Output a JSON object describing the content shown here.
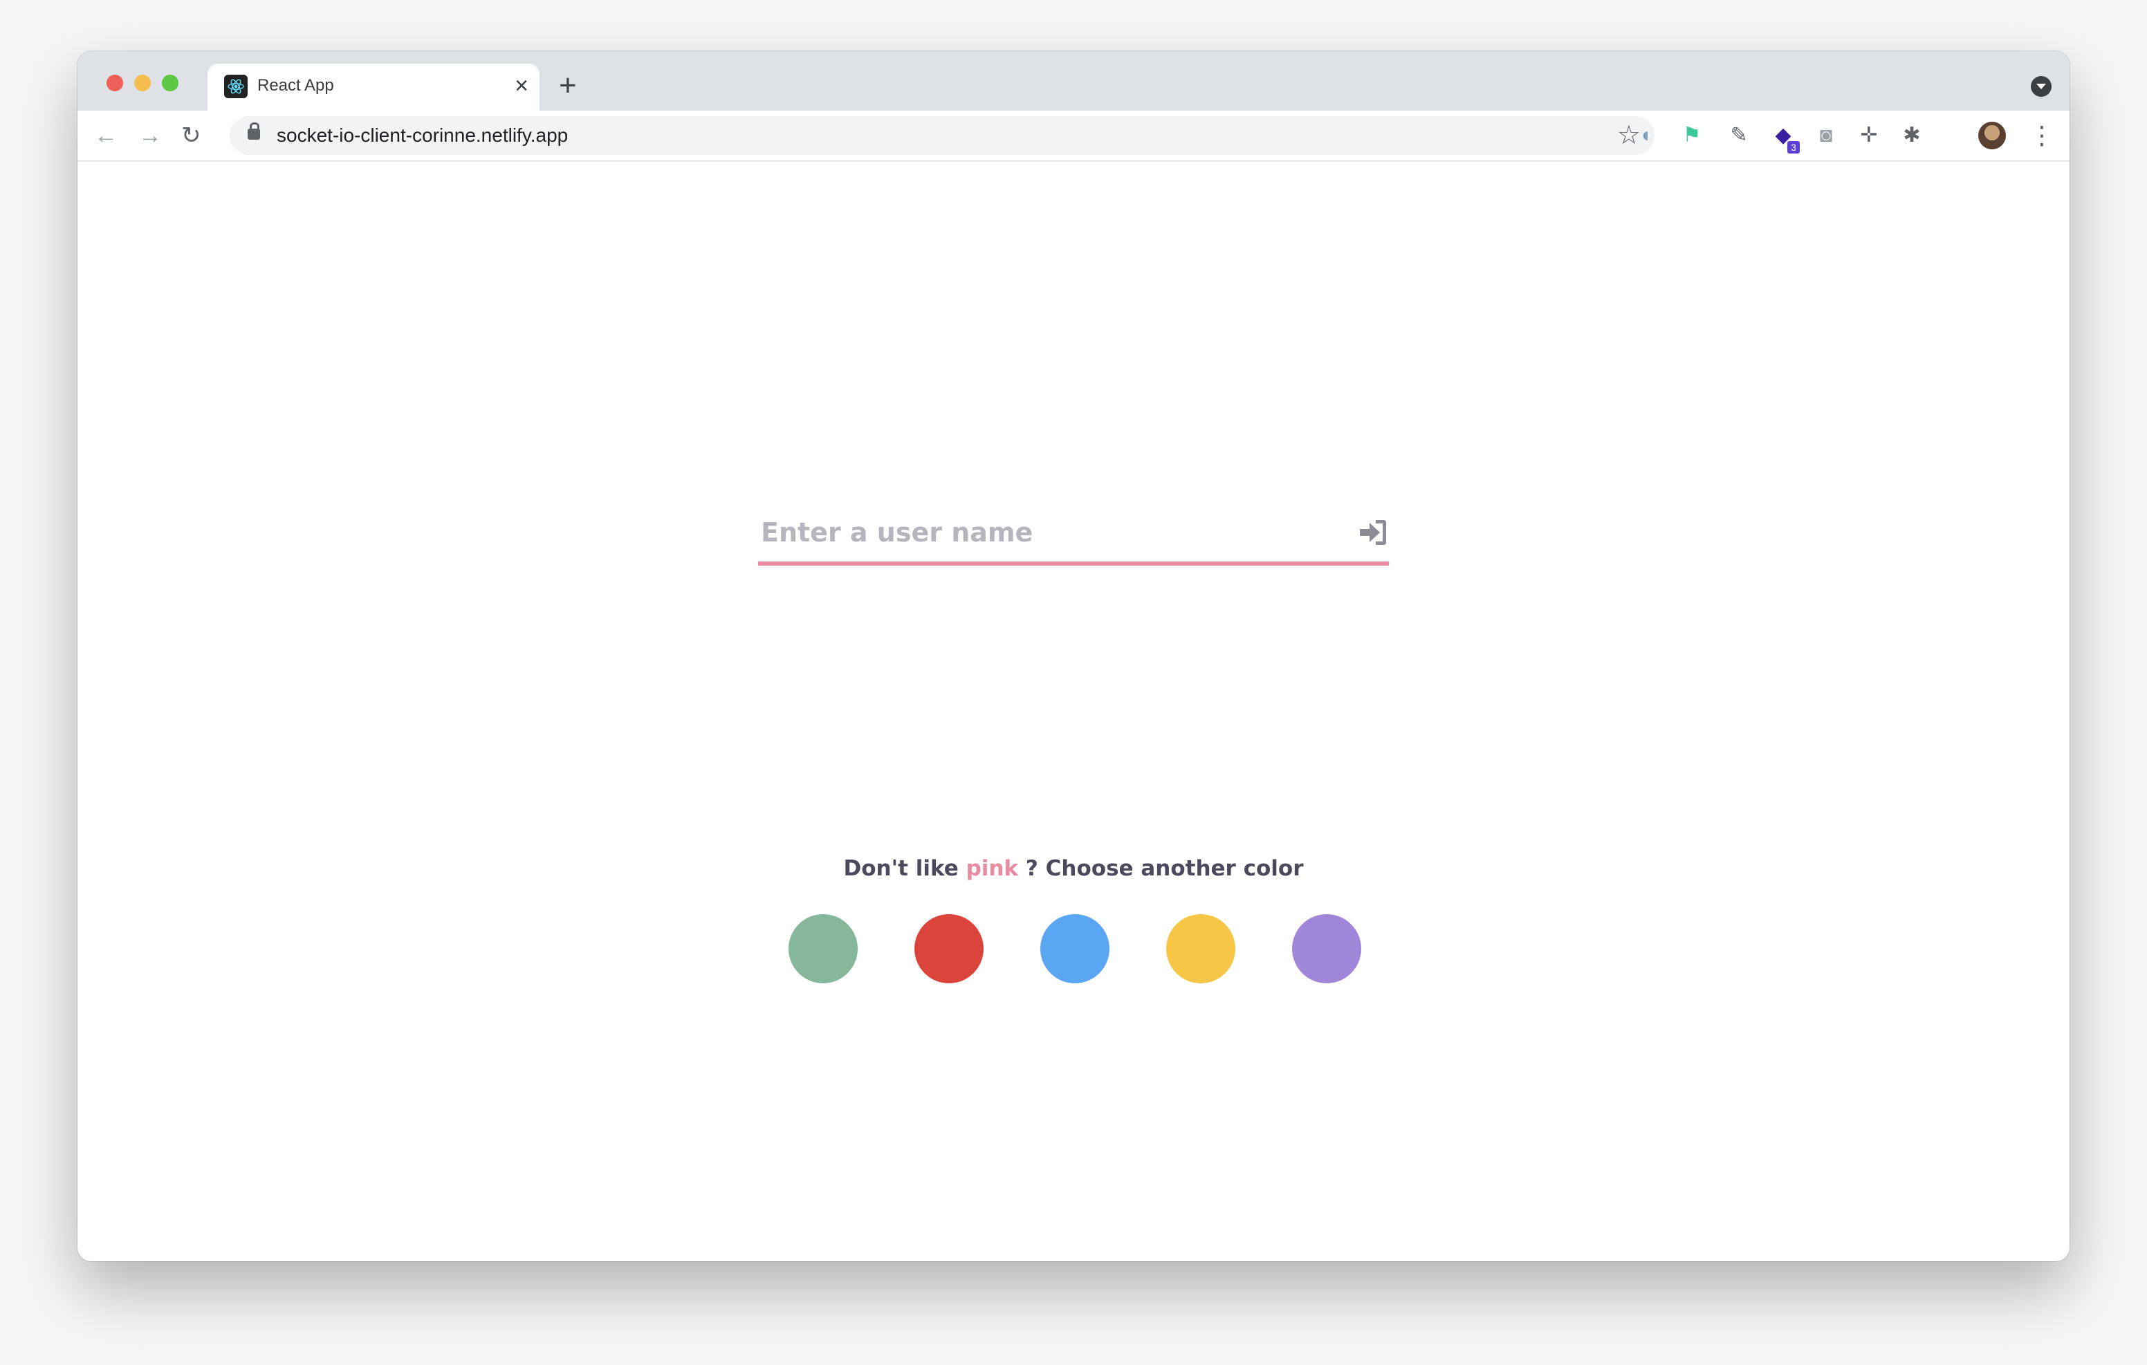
{
  "browser": {
    "tab_title": "React App",
    "tab_close": "×",
    "new_tab": "+",
    "url": "socket-io-client-corinne.netlify.app",
    "nav": {
      "back": "←",
      "forward": "→",
      "reload": "↻"
    },
    "bookmark_star": "☆",
    "menu": "⋮",
    "extensions": [
      {
        "name": "privacy-badger-icon",
        "glyph": "◐",
        "color": "#7ea1c4"
      },
      {
        "name": "hummingbird-icon",
        "glyph": "⚑",
        "color": "#3cc79a"
      },
      {
        "name": "color-picker-icon",
        "glyph": "✎",
        "color": "#5f6368"
      },
      {
        "name": "graduation-cap-icon",
        "glyph": "◆",
        "color": "#3b1fa3",
        "badge": "3"
      },
      {
        "name": "camera-icon",
        "glyph": "◙",
        "color": "#9aa0a6"
      },
      {
        "name": "ruler-icon",
        "glyph": "✛",
        "color": "#5f6368"
      },
      {
        "name": "puzzle-icon",
        "glyph": "✱",
        "color": "#5f6368"
      }
    ]
  },
  "login": {
    "placeholder": "Enter a user name",
    "value": "",
    "accent_color": "#e88aa0"
  },
  "color_picker": {
    "prompt_before": "Don't like",
    "current_color": "pink",
    "prompt_after": "? Choose another color",
    "options": [
      {
        "name": "green",
        "hex": "#85b79b"
      },
      {
        "name": "red",
        "hex": "#da443b"
      },
      {
        "name": "blue",
        "hex": "#5ba6f2"
      },
      {
        "name": "yellow",
        "hex": "#f7c546"
      },
      {
        "name": "purple",
        "hex": "#a086d8"
      }
    ]
  }
}
